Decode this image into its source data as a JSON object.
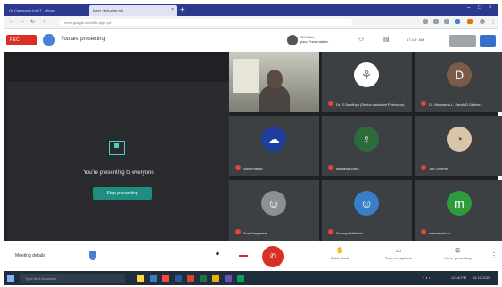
{
  "browser": {
    "tabs": [
      {
        "label": "(1) Classroom for IIT - Miga x",
        "active": false
      },
      {
        "label": "Meet - tbh-qrjm-ydr",
        "active": true
      }
    ],
    "new_tab": "+",
    "window_controls": [
      "–",
      "□",
      "×"
    ],
    "address": "meet.google.com/tbh-qrjm-ydr"
  },
  "meet_top": {
    "recording_label": "REC",
    "presenting_label": "You are presenting",
    "presenter_name": "Sri Nithi...",
    "presenter_sub": "your Presentation",
    "time": "17:14 · AM"
  },
  "present_panel": {
    "message": "You're presenting to everyone",
    "stop_button": "Stop presenting"
  },
  "participants": [
    {
      "name": "Self view",
      "type": "video"
    },
    {
      "name": "Dr. S.Sandhya (Senior Assistant Professor)",
      "type": "avatar",
      "initial": "",
      "color": "#ffffff"
    },
    {
      "name": "Dr. Marisama L. Sarah D.Sabine...",
      "type": "avatar",
      "initial": "D",
      "color": "#7b5a4a"
    },
    {
      "name": "Vani Prasad",
      "type": "avatar",
      "initial": "",
      "color": "#1f3fa0"
    },
    {
      "name": "Manisha Joshi",
      "type": "avatar",
      "initial": "",
      "color": "#2e6b3a"
    },
    {
      "name": "Jeff Greene",
      "type": "avatar",
      "initial": "",
      "color": "#d9c6a8"
    },
    {
      "name": "Sam Varghese",
      "type": "avatar",
      "initial": "",
      "color": "#8c8f94"
    },
    {
      "name": "Soumya Mathew",
      "type": "avatar",
      "initial": "",
      "color": "#3a7ec8"
    },
    {
      "name": "meenakshi m",
      "type": "avatar",
      "initial": "m",
      "color": "#2d9c3c"
    }
  ],
  "bottom_bar": {
    "meeting_details": "Meeting details",
    "raise_hand": "Raise hand",
    "turn_on_captions": "Turn on captions",
    "stop_presenting": "You're presenting",
    "end_call": "✆"
  },
  "taskbar": {
    "search_placeholder": "Type here to search",
    "time": "12:46 PM",
    "date": "04-11-2020"
  }
}
